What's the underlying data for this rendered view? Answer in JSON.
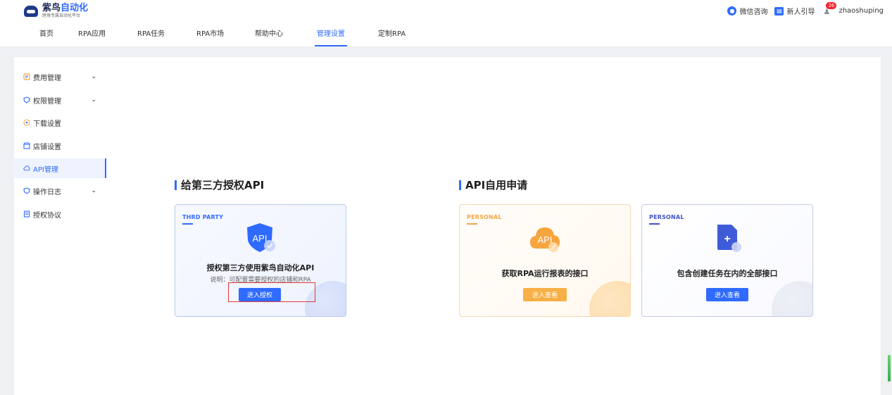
{
  "header": {
    "logo_title_a": "紫鸟",
    "logo_title_b": "自动化",
    "logo_subtitle": "跨境专属自动化平台",
    "nav": [
      {
        "label": "首页"
      },
      {
        "label": "RPA应用"
      },
      {
        "label": "RPA任务"
      },
      {
        "label": "RPA市场"
      },
      {
        "label": "帮助中心"
      },
      {
        "label": "管理设置"
      },
      {
        "label": "定制RPA"
      }
    ],
    "active_nav": "管理设置",
    "wechat_label": "微信咨询",
    "guide_label": "新人引导",
    "notification_count": "26",
    "username": "zhaoshuping"
  },
  "sidebar": {
    "items": [
      {
        "label": "费用管理",
        "icon": "bill-icon",
        "expandable": true
      },
      {
        "label": "权限管理",
        "icon": "shield-icon",
        "expandable": true
      },
      {
        "label": "下载设置",
        "icon": "download-icon",
        "expandable": false
      },
      {
        "label": "店铺设置",
        "icon": "store-icon",
        "expandable": false
      },
      {
        "label": "API管理",
        "icon": "cloud-icon",
        "expandable": false,
        "active": true
      },
      {
        "label": "操作日志",
        "icon": "shield-icon",
        "expandable": true
      },
      {
        "label": "授权协议",
        "icon": "document-icon",
        "expandable": false
      }
    ]
  },
  "main": {
    "section_third_party": "给第三方授权API",
    "section_self": "API自用申请",
    "cards": [
      {
        "tag": "THRD PARTY",
        "icon_text": "API",
        "title": "授权第三方使用紫鸟自动化API",
        "desc": "说明：可配置需要授权的店铺和RPA",
        "button": "进入授权"
      },
      {
        "tag": "PERSONAL",
        "icon_text": "API",
        "title": "获取RPA运行报表的接口",
        "button": "进入查看"
      },
      {
        "tag": "PERSONAL",
        "icon_text": "+",
        "title": "包含创建任务在内的全部接口",
        "button": "进入查看"
      }
    ]
  },
  "colors": {
    "accent": "#2f6bff",
    "orange": "#f7b046",
    "highlight": "#e53935"
  }
}
